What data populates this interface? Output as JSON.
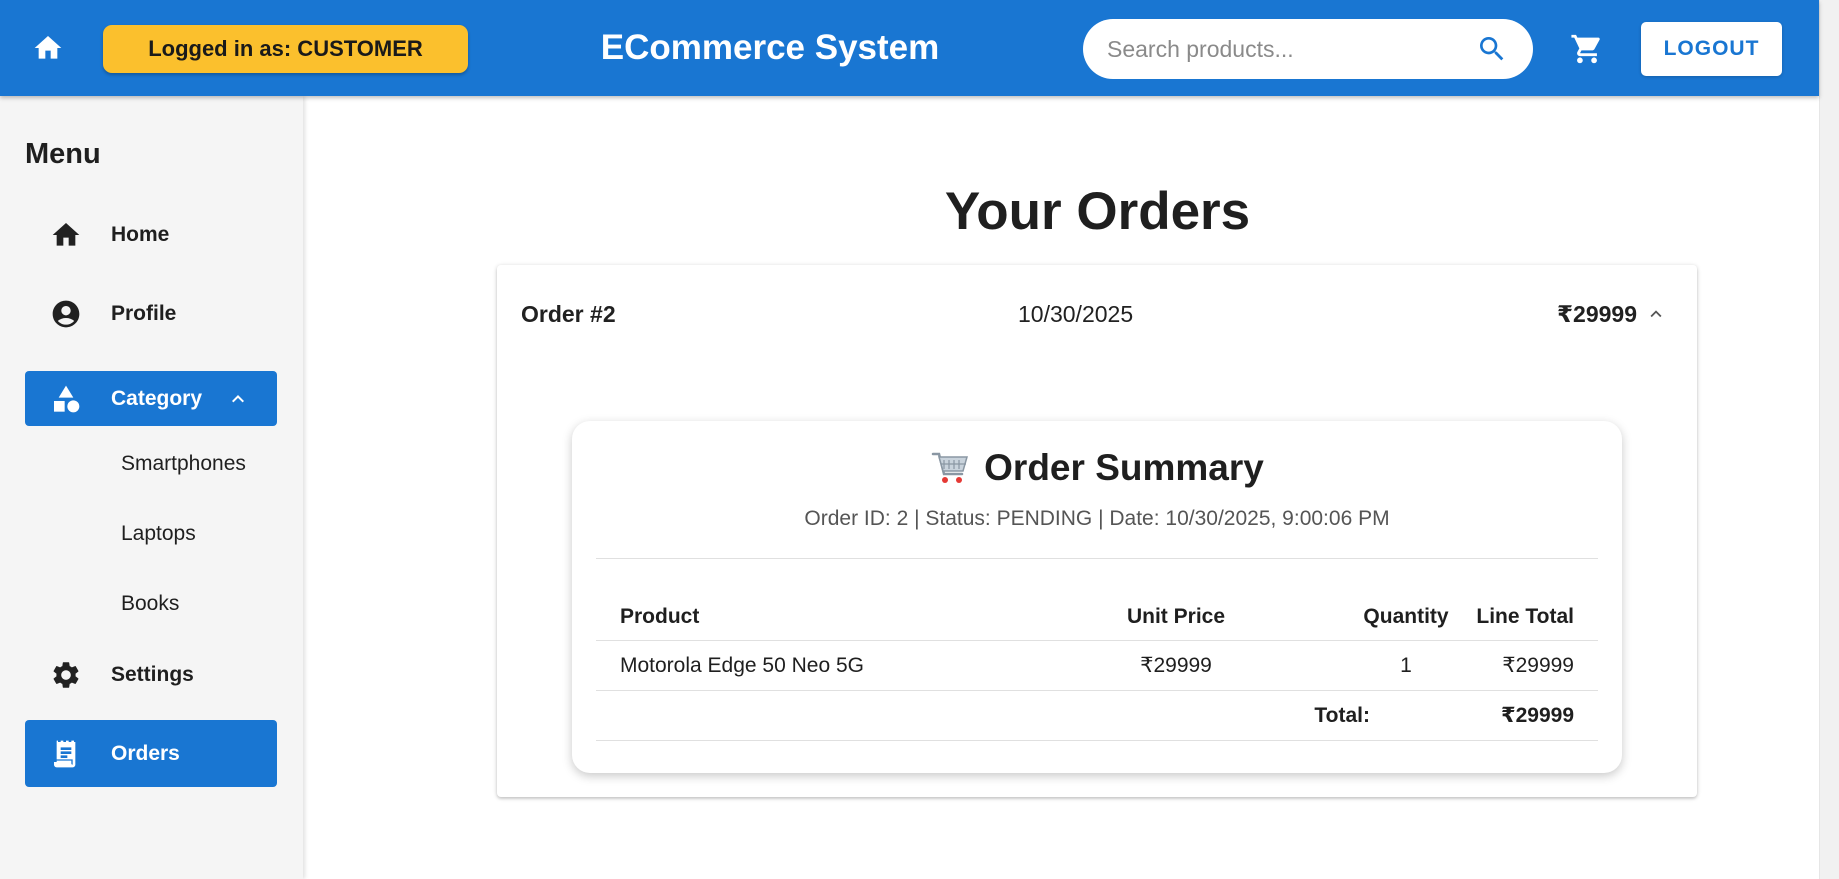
{
  "header": {
    "role_badge": "Logged in as: CUSTOMER",
    "title": "ECommerce System",
    "search_placeholder": "Search products...",
    "logout_label": "LOGOUT"
  },
  "sidebar": {
    "title": "Menu",
    "items": [
      {
        "label": "Home",
        "icon": "home-icon"
      },
      {
        "label": "Profile",
        "icon": "account-circle-icon"
      },
      {
        "label": "Category",
        "icon": "category-shapes-icon",
        "expanded": true,
        "children": [
          "Smartphones",
          "Laptops",
          "Books"
        ]
      },
      {
        "label": "Settings",
        "icon": "gear-icon"
      },
      {
        "label": "Orders",
        "icon": "receipt-icon",
        "active": true
      }
    ]
  },
  "main": {
    "page_title": "Your Orders",
    "order": {
      "number": "Order #2",
      "date": "10/30/2025",
      "total": "₹29999",
      "summary": {
        "title": "Order Summary",
        "meta": "Order ID: 2 | Status: PENDING | Date: 10/30/2025, 9:00:06 PM",
        "columns": [
          "Product",
          "Unit Price",
          "Quantity",
          "Line Total"
        ],
        "rows": [
          {
            "product": "Motorola Edge 50 Neo 5G",
            "unit_price": "₹29999",
            "quantity": "1",
            "line_total": "₹29999"
          }
        ],
        "total_label": "Total:",
        "total_value": "₹29999"
      }
    }
  },
  "colors": {
    "primary": "#1976d2",
    "badge": "#fbc02d",
    "sidebar_bg": "#f5f5f5"
  }
}
